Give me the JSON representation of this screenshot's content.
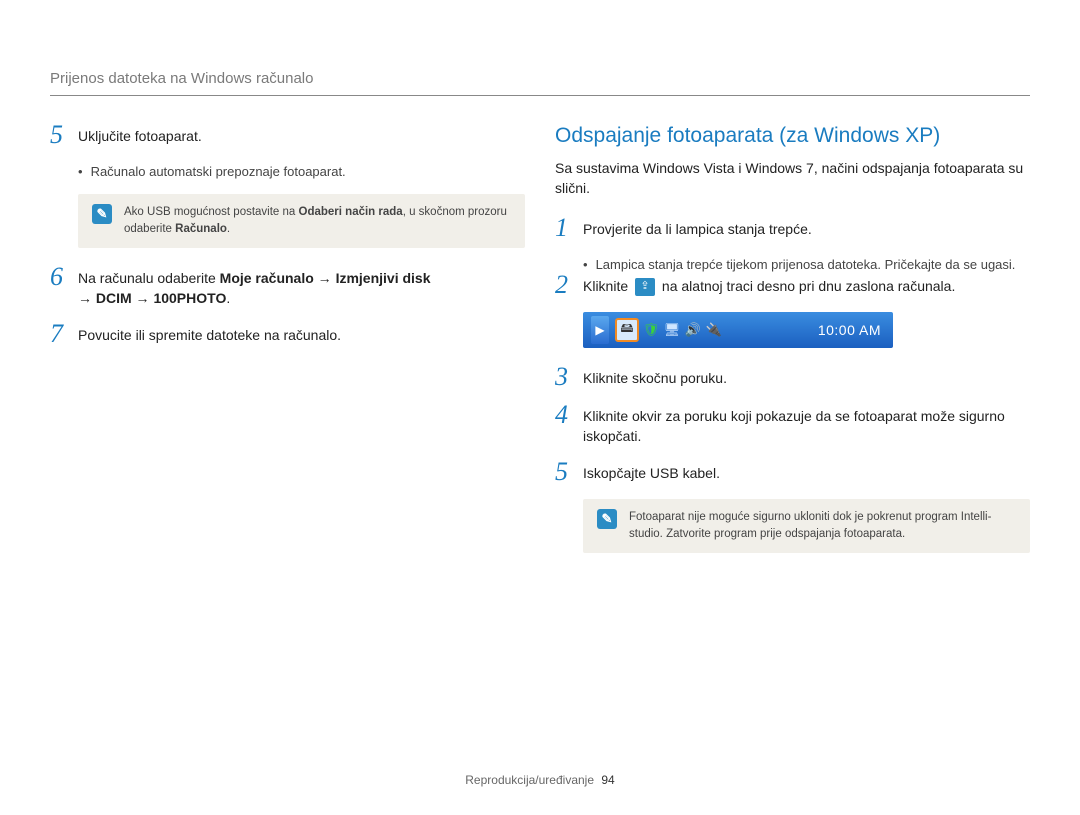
{
  "header": "Prijenos datoteka na Windows računalo",
  "left": {
    "step5": {
      "num": "5",
      "text": "Uključite fotoaparat.",
      "bullet": "Računalo automatski prepoznaje fotoaparat."
    },
    "note1": {
      "pre": "Ako USB mogućnost postavite na ",
      "bold1": "Odaberi način rada",
      "mid": ", u skočnom prozoru odaberite ",
      "bold2": "Računalo",
      "suffix": "."
    },
    "step6": {
      "num": "6",
      "pre": "Na računalu odaberite ",
      "b1": "Moje računalo",
      "arrow": " → ",
      "b2": "Izmjenjivi disk",
      "b3": "DCIM",
      "b4": "100PHOTO",
      "suffix": "."
    },
    "step7": {
      "num": "7",
      "text": "Povucite ili spremite datoteke na računalo."
    }
  },
  "right": {
    "title": "Odspajanje fotoaparata (za Windows XP)",
    "intro": "Sa sustavima Windows Vista i Windows 7, načini odspajanja fotoaparata su slični.",
    "step1": {
      "num": "1",
      "text": "Provjerite da li lampica stanja trepće.",
      "bullet": "Lampica stanja trepće tijekom prijenosa datoteka. Pričekajte da se ugasi."
    },
    "step2": {
      "num": "2",
      "pre": "Kliknite ",
      "post": " na alatnoj traci desno pri dnu zaslona računala."
    },
    "taskbar_time": "10:00 AM",
    "step3": {
      "num": "3",
      "text": "Kliknite skočnu poruku."
    },
    "step4": {
      "num": "4",
      "text": "Kliknite okvir za poruku koji pokazuje da se fotoaparat može sigurno iskopčati."
    },
    "step5": {
      "num": "5",
      "text": "Iskopčajte USB kabel."
    },
    "note2": "Fotoaparat nije moguće sigurno ukloniti dok je pokrenut program Intelli-studio. Zatvorite program prije odspajanja fotoaparata."
  },
  "footer": {
    "label": "Reprodukcija/uređivanje",
    "page": "94"
  }
}
